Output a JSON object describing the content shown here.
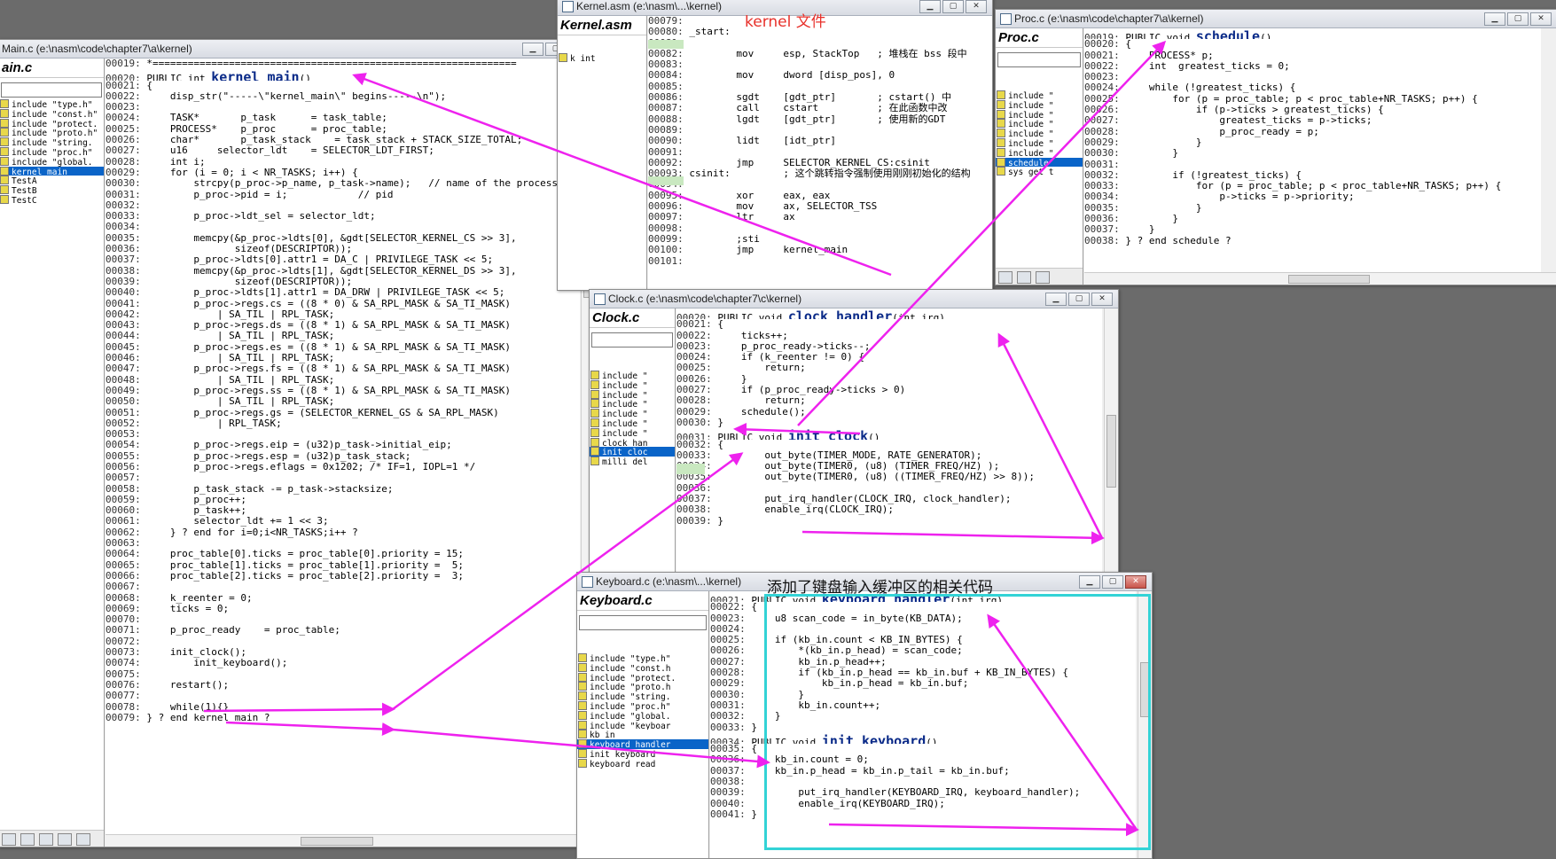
{
  "annotation_kernel": "kernel 文件",
  "annotation_keyboard": "添加了键盘输入缓冲区的相关代码",
  "main": {
    "title": "Main.c (e:\\nasm\\code\\chapter7\\a\\kernel)",
    "panel": "ain.c",
    "symbols": [
      "include \"type.h\"",
      "include \"const.h\"",
      "include \"protect.",
      "include \"proto.h\"",
      "include \"string.",
      "include \"proc.h\"",
      "include \"global.",
      "kernel_main",
      "TestA",
      "TestB",
      "TestC"
    ],
    "lines": [
      [
        "00019:",
        " *=============================================================="
      ],
      [
        "00020:",
        " PUBLIC int ",
        "kernel_main",
        "()"
      ],
      [
        "00021:",
        " {"
      ],
      [
        "00022:",
        "     disp_str(\"-----\\\"kernel_main\\\" begins-----\\n\");"
      ],
      [
        "00023:",
        ""
      ],
      [
        "00024:",
        "     TASK*       p_task      = task_table;"
      ],
      [
        "00025:",
        "     PROCESS*    p_proc      = proc_table;"
      ],
      [
        "00026:",
        "     char*       p_task_stack    = task_stack + STACK_SIZE_TOTAL;"
      ],
      [
        "00027:",
        "     u16     selector_ldt    = SELECTOR_LDT_FIRST;"
      ],
      [
        "00028:",
        "     int i;"
      ],
      [
        "00029:",
        "     for (i = 0; i < NR_TASKS; i++) {"
      ],
      [
        "00030:",
        "         strcpy(p_proc->p_name, p_task->name);   // name of the process"
      ],
      [
        "00031:",
        "         p_proc->pid = i;            // pid"
      ],
      [
        "00032:",
        ""
      ],
      [
        "00033:",
        "         p_proc->ldt_sel = selector_ldt;"
      ],
      [
        "00034:",
        ""
      ],
      [
        "00035:",
        "         memcpy(&p_proc->ldts[0], &gdt[SELECTOR_KERNEL_CS >> 3],"
      ],
      [
        "00036:",
        "                sizeof(DESCRIPTOR));"
      ],
      [
        "00037:",
        "         p_proc->ldts[0].attr1 = DA_C | PRIVILEGE_TASK << 5;"
      ],
      [
        "00038:",
        "         memcpy(&p_proc->ldts[1], &gdt[SELECTOR_KERNEL_DS >> 3],"
      ],
      [
        "00039:",
        "                sizeof(DESCRIPTOR));"
      ],
      [
        "00040:",
        "         p_proc->ldts[1].attr1 = DA_DRW | PRIVILEGE_TASK << 5;"
      ],
      [
        "00041:",
        "         p_proc->regs.cs = ((8 * 0) & SA_RPL_MASK & SA_TI_MASK)"
      ],
      [
        "00042:",
        "             | SA_TIL | RPL_TASK;"
      ],
      [
        "00043:",
        "         p_proc->regs.ds = ((8 * 1) & SA_RPL_MASK & SA_TI_MASK)"
      ],
      [
        "00044:",
        "             | SA_TIL | RPL_TASK;"
      ],
      [
        "00045:",
        "         p_proc->regs.es = ((8 * 1) & SA_RPL_MASK & SA_TI_MASK)"
      ],
      [
        "00046:",
        "             | SA_TIL | RPL_TASK;"
      ],
      [
        "00047:",
        "         p_proc->regs.fs = ((8 * 1) & SA_RPL_MASK & SA_TI_MASK)"
      ],
      [
        "00048:",
        "             | SA_TIL | RPL_TASK;"
      ],
      [
        "00049:",
        "         p_proc->regs.ss = ((8 * 1) & SA_RPL_MASK & SA_TI_MASK)"
      ],
      [
        "00050:",
        "             | SA_TIL | RPL_TASK;"
      ],
      [
        "00051:",
        "         p_proc->regs.gs = (SELECTOR_KERNEL_GS & SA_RPL_MASK)"
      ],
      [
        "00052:",
        "             | RPL_TASK;"
      ],
      [
        "00053:",
        ""
      ],
      [
        "00054:",
        "         p_proc->regs.eip = (u32)p_task->initial_eip;"
      ],
      [
        "00055:",
        "         p_proc->regs.esp = (u32)p_task_stack;"
      ],
      [
        "00056:",
        "         p_proc->regs.eflags = 0x1202; /* IF=1, IOPL=1 */"
      ],
      [
        "00057:",
        ""
      ],
      [
        "00058:",
        "         p_task_stack -= p_task->stacksize;"
      ],
      [
        "00059:",
        "         p_proc++;"
      ],
      [
        "00060:",
        "         p_task++;"
      ],
      [
        "00061:",
        "         selector_ldt += 1 << 3;"
      ],
      [
        "00062:",
        "     } ? end for i=0;i<NR_TASKS;i++ ?"
      ],
      [
        "00063:",
        ""
      ],
      [
        "00064:",
        "     proc_table[0].ticks = proc_table[0].priority = 15;"
      ],
      [
        "00065:",
        "     proc_table[1].ticks = proc_table[1].priority =  5;"
      ],
      [
        "00066:",
        "     proc_table[2].ticks = proc_table[2].priority =  3;"
      ],
      [
        "00067:",
        ""
      ],
      [
        "00068:",
        "     k_reenter = 0;"
      ],
      [
        "00069:",
        "     ticks = 0;"
      ],
      [
        "00070:",
        ""
      ],
      [
        "00071:",
        "     p_proc_ready    = proc_table;"
      ],
      [
        "00072:",
        ""
      ],
      [
        "00073:",
        "     init_clock();"
      ],
      [
        "00074:",
        "         init_keyboard();"
      ],
      [
        "00075:",
        ""
      ],
      [
        "00076:",
        "     restart();"
      ],
      [
        "00077:",
        ""
      ],
      [
        "00078:",
        "     while(1){}"
      ],
      [
        "00079:",
        " } ? end kernel_main ?"
      ]
    ]
  },
  "kernel": {
    "title": "Kernel.asm (e:\\nasm\\...\\kernel)",
    "panel": "Kernel.asm",
    "symbols": [
      "k_int"
    ],
    "lines": [
      [
        "00079:",
        ""
      ],
      [
        "00080:",
        " _start:"
      ],
      [
        "00081:",
        ""
      ],
      [
        "00082:",
        "         mov     esp, StackTop   ; 堆栈在 bss 段中"
      ],
      [
        "00083:",
        ""
      ],
      [
        "00084:",
        "         mov     dword [disp_pos], 0"
      ],
      [
        "00085:",
        ""
      ],
      [
        "00086:",
        "         sgdt    [gdt_ptr]       ; cstart() 中"
      ],
      [
        "00087:",
        "         call    cstart          ; 在此函数中改"
      ],
      [
        "00088:",
        "         lgdt    [gdt_ptr]       ; 使用新的GDT"
      ],
      [
        "00089:",
        ""
      ],
      [
        "00090:",
        "         lidt    [idt_ptr]"
      ],
      [
        "00091:",
        ""
      ],
      [
        "00092:",
        "         jmp     SELECTOR_KERNEL_CS:csinit"
      ],
      [
        "00093:",
        " csinit:         ; 这个跳转指令强制使用刚刚初始化的结构"
      ],
      [
        "00094:",
        ""
      ],
      [
        "00095:",
        "         xor     eax, eax"
      ],
      [
        "00096:",
        "         mov     ax, SELECTOR_TSS"
      ],
      [
        "00097:",
        "         ltr     ax"
      ],
      [
        "00098:",
        ""
      ],
      [
        "00099:",
        "         ;sti"
      ],
      [
        "00100:",
        "         jmp     kernel_main"
      ],
      [
        "00101:",
        ""
      ]
    ]
  },
  "proc": {
    "title": "Proc.c (e:\\nasm\\code\\chapter7\\a\\kernel)",
    "panel": "Proc.c",
    "symbols": [
      "include \"",
      "include \"",
      "include \"",
      "include \"",
      "include \"",
      "include \"",
      "include \"",
      "schedule",
      "sys_get_t"
    ],
    "lines": [
      [
        "00019:",
        " PUBLIC void ",
        "schedule",
        "()"
      ],
      [
        "00020:",
        " {"
      ],
      [
        "00021:",
        "     PROCESS* p;"
      ],
      [
        "00022:",
        "     int  greatest_ticks = 0;"
      ],
      [
        "00023:",
        ""
      ],
      [
        "00024:",
        "     while (!greatest_ticks) {"
      ],
      [
        "00025:",
        "         for (p = proc_table; p < proc_table+NR_TASKS; p++) {"
      ],
      [
        "00026:",
        "             if (p->ticks > greatest_ticks) {"
      ],
      [
        "00027:",
        "                 greatest_ticks = p->ticks;"
      ],
      [
        "00028:",
        "                 p_proc_ready = p;"
      ],
      [
        "00029:",
        "             }"
      ],
      [
        "00030:",
        "         }"
      ],
      [
        "00031:",
        ""
      ],
      [
        "00032:",
        "         if (!greatest_ticks) {"
      ],
      [
        "00033:",
        "             for (p = proc_table; p < proc_table+NR_TASKS; p++) {"
      ],
      [
        "00034:",
        "                 p->ticks = p->priority;"
      ],
      [
        "00035:",
        "             }"
      ],
      [
        "00036:",
        "         }"
      ],
      [
        "00037:",
        "     }"
      ],
      [
        "00038:",
        " } ? end schedule ?"
      ]
    ]
  },
  "clock": {
    "title": "Clock.c (e:\\nasm\\code\\chapter7\\c\\kernel)",
    "panel": "Clock.c",
    "symbols": [
      "include \"",
      "include \"",
      "include \"",
      "include \"",
      "include \"",
      "include \"",
      "include \"",
      "clock_han",
      "init_cloc",
      "milli_del"
    ],
    "lines": [
      [
        "00020:",
        " PUBLIC void ",
        "clock_handler",
        "(int irq)"
      ],
      [
        "00021:",
        " {"
      ],
      [
        "00022:",
        "     ticks++;"
      ],
      [
        "00023:",
        "     p_proc_ready->ticks--;"
      ],
      [
        "00024:",
        "     if (k_reenter != 0) {"
      ],
      [
        "00025:",
        "         return;"
      ],
      [
        "00026:",
        "     }"
      ],
      [
        "00027:",
        "     if (p_proc_ready->ticks > 0)"
      ],
      [
        "00028:",
        "         return;"
      ],
      [
        "00029:",
        "     schedule();"
      ],
      [
        "00030:",
        " }"
      ],
      [
        "00031:",
        " PUBLIC void ",
        "init_clock",
        "()"
      ],
      [
        "00032:",
        " {"
      ],
      [
        "00033:",
        "         out_byte(TIMER_MODE, RATE_GENERATOR);"
      ],
      [
        "00034:",
        "         out_byte(TIMER0, (u8) (TIMER_FREQ/HZ) );"
      ],
      [
        "00035:",
        "         out_byte(TIMER0, (u8) ((TIMER_FREQ/HZ) >> 8));"
      ],
      [
        "00036:",
        ""
      ],
      [
        "00037:",
        "         put_irq_handler(CLOCK_IRQ, clock_handler);"
      ],
      [
        "00038:",
        "         enable_irq(CLOCK_IRQ);"
      ],
      [
        "00039:",
        " }"
      ]
    ]
  },
  "keyboard": {
    "title": "Keyboard.c (e:\\nasm\\...\\kernel)",
    "panel": "Keyboard.c",
    "symbols": [
      "include \"type.h\"",
      "include \"const.h",
      "include \"protect.",
      "include \"proto.h",
      "include \"string.",
      "include \"proc.h\"",
      "include \"global.",
      "include \"keyboar",
      "kb_in",
      "keyboard_handler",
      "init_keyboard",
      "keyboard_read"
    ],
    "lines": [
      [
        "00021:",
        " PUBLIC void ",
        "keyboard_handler",
        "(int irq)"
      ],
      [
        "00022:",
        " {"
      ],
      [
        "00023:",
        "     u8 scan_code = in_byte(KB_DATA);"
      ],
      [
        "00024:",
        ""
      ],
      [
        "00025:",
        "     if (kb_in.count < KB_IN_BYTES) {"
      ],
      [
        "00026:",
        "         *(kb_in.p_head) = scan_code;"
      ],
      [
        "00027:",
        "         kb_in.p_head++;"
      ],
      [
        "00028:",
        "         if (kb_in.p_head == kb_in.buf + KB_IN_BYTES) {"
      ],
      [
        "00029:",
        "             kb_in.p_head = kb_in.buf;"
      ],
      [
        "00030:",
        "         }"
      ],
      [
        "00031:",
        "         kb_in.count++;"
      ],
      [
        "00032:",
        "     }"
      ],
      [
        "00033:",
        " }"
      ],
      [
        "00034:",
        " PUBLIC void ",
        "init_keyboard",
        "()"
      ],
      [
        "00035:",
        " {"
      ],
      [
        "00036:",
        "     kb_in.count = 0;"
      ],
      [
        "00037:",
        "     kb_in.p_head = kb_in.p_tail = kb_in.buf;"
      ],
      [
        "00038:",
        ""
      ],
      [
        "00039:",
        "         put_irq_handler(KEYBOARD_IRQ, keyboard_handler);"
      ],
      [
        "00040:",
        "         enable_irq(KEYBOARD_IRQ);"
      ],
      [
        "00041:",
        " }"
      ]
    ]
  }
}
